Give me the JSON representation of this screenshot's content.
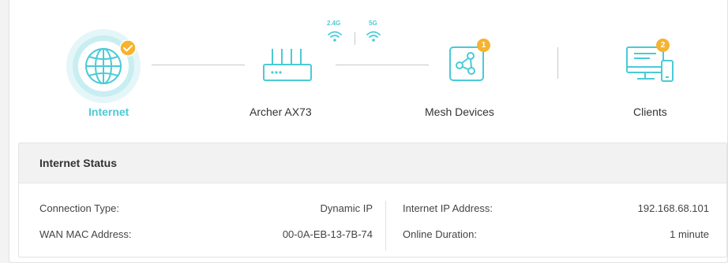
{
  "topology": {
    "nodes": [
      {
        "label": "Internet",
        "icon": "globe-icon",
        "status": "check-icon",
        "active": true
      },
      {
        "label": "Archer AX73",
        "icon": "router-icon"
      },
      {
        "label": "Mesh Devices",
        "icon": "mesh-icon",
        "badge": "1"
      },
      {
        "label": "Clients",
        "icon": "clients-icon",
        "badge": "2"
      }
    ],
    "bands": [
      {
        "label": "2.4G",
        "icon": "wifi-icon"
      },
      {
        "label": "5G",
        "icon": "wifi-icon"
      }
    ]
  },
  "internet_status": {
    "title": "Internet Status",
    "connection_type": {
      "label": "Connection Type:",
      "value": "Dynamic IP"
    },
    "wan_mac": {
      "label": "WAN MAC Address:",
      "value": "00-0A-EB-13-7B-74"
    },
    "ip_address": {
      "label": "Internet IP Address:",
      "value": "192.168.68.101"
    },
    "online_duration": {
      "label": "Online Duration:",
      "value": "1 minute"
    }
  },
  "colors": {
    "accent": "#4acbd6",
    "badge": "#f5b32e",
    "check": "#f5b32e"
  }
}
